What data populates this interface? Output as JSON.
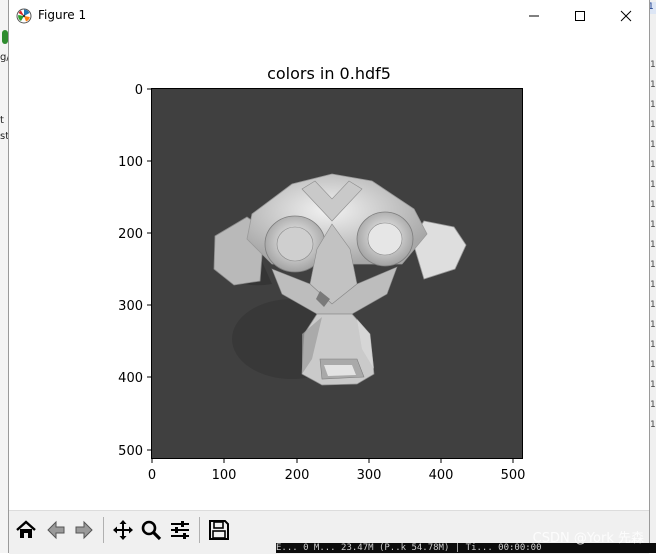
{
  "window": {
    "title": "Figure 1"
  },
  "background": {
    "left_fragments": [
      "g/",
      "t",
      "st"
    ],
    "right_fragments": [
      "1",
      "1",
      "1",
      "1",
      "1",
      "1",
      "1",
      "1",
      "1",
      "1",
      "1",
      "1",
      "1",
      "1",
      "1",
      "1",
      "1",
      "1",
      "1",
      "1"
    ],
    "terminal_line": "E... 0 M... 23.47M (P..k 54.78M) | Ti... 00:00:00"
  },
  "plot": {
    "title": "colors in 0.hdf5",
    "x_ticks": [
      "0",
      "100",
      "200",
      "300",
      "400",
      "500"
    ],
    "y_ticks": [
      "0",
      "100",
      "200",
      "300",
      "400",
      "500"
    ],
    "image_background_color": "#404040"
  },
  "toolbar": {
    "buttons": [
      "home",
      "back",
      "forward",
      "pan",
      "zoom",
      "configure-subplots",
      "save"
    ]
  },
  "watermark": "CSDN @York 先森"
}
